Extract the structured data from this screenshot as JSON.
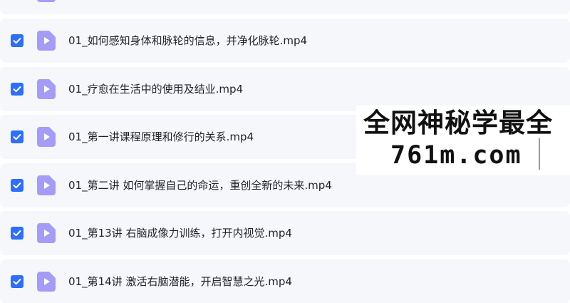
{
  "colors": {
    "row_background": "#f6f7fb",
    "checkbox_checked": "#2f6ef5",
    "file_icon": "#a59cf6",
    "text": "#1f2329"
  },
  "files": [
    {
      "name": "",
      "checked": true,
      "icon": "video-file-icon"
    },
    {
      "name": "01_如何感知身体和脉轮的信息，并净化脉轮.mp4",
      "checked": true,
      "icon": "video-file-icon"
    },
    {
      "name": "01_疗愈在生活中的使用及结业.mp4",
      "checked": true,
      "icon": "video-file-icon"
    },
    {
      "name": "01_第一讲课程原理和修行的关系.mp4",
      "checked": true,
      "icon": "video-file-icon"
    },
    {
      "name": "01_第二讲 如何掌握自己的命运，重创全新的未来.mp4",
      "checked": true,
      "icon": "video-file-icon"
    },
    {
      "name": "01_第13讲 右脑成像力训练，打开内视觉.mp4",
      "checked": true,
      "icon": "video-file-icon"
    },
    {
      "name": "01_第14讲 激活右脑潜能，开启智慧之光.mp4",
      "checked": true,
      "icon": "video-file-icon"
    }
  ],
  "watermark": {
    "line1": "全网神秘学最全",
    "line2": "761m.com"
  }
}
